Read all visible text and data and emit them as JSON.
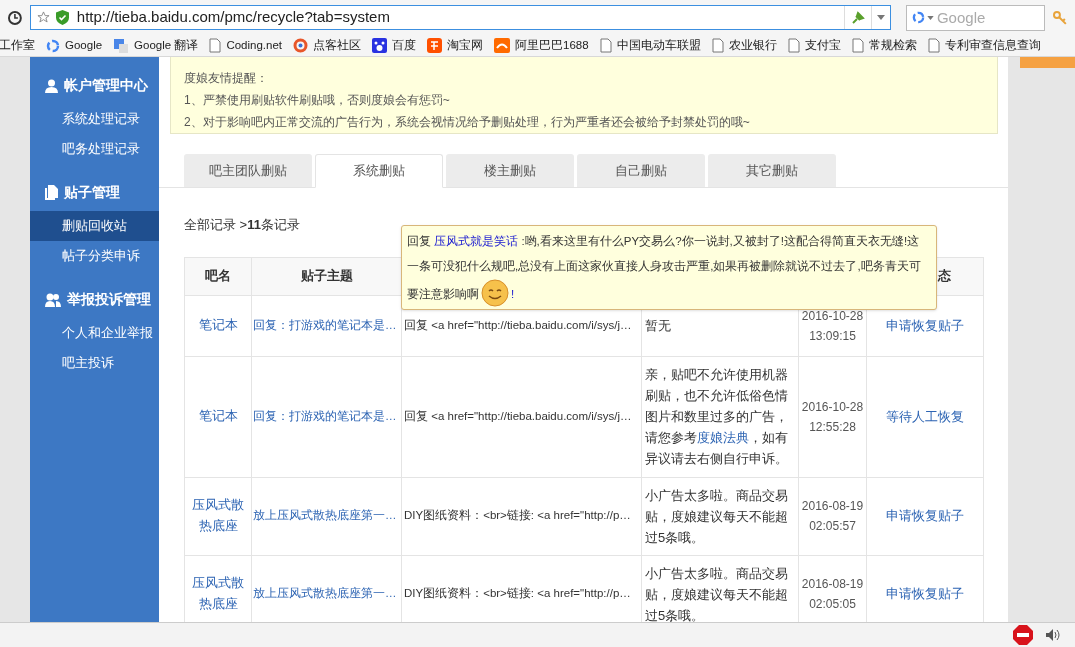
{
  "browser": {
    "url": "http://tieba.baidu.com/pmc/recycle?tab=system",
    "search_placeholder": "Google"
  },
  "bookmarks": [
    {
      "label": "工作室",
      "kind": "none"
    },
    {
      "label": "Google",
      "kind": "google"
    },
    {
      "label": "Google 翻译",
      "kind": "translate"
    },
    {
      "label": "Coding.net",
      "kind": "page"
    },
    {
      "label": "点客社区",
      "kind": "ring"
    },
    {
      "label": "百度",
      "kind": "paw"
    },
    {
      "label": "淘宝网",
      "kind": "taobao"
    },
    {
      "label": "阿里巴巴1688",
      "kind": "alibaba"
    },
    {
      "label": "中国电动车联盟",
      "kind": "page"
    },
    {
      "label": "农业银行",
      "kind": "page"
    },
    {
      "label": "支付宝",
      "kind": "page"
    },
    {
      "label": "常规检索",
      "kind": "page"
    },
    {
      "label": "专利审查信息查询",
      "kind": "page"
    }
  ],
  "sidebar": [
    {
      "title": "帐户管理中心",
      "kind": "user",
      "items": [
        {
          "label": "系统处理记录",
          "selected": false
        },
        {
          "label": "吧务处理记录",
          "selected": false
        }
      ]
    },
    {
      "title": "贴子管理",
      "kind": "docs",
      "items": [
        {
          "label": "删贴回收站",
          "selected": true
        },
        {
          "label": "帖子分类申诉",
          "selected": false
        }
      ]
    },
    {
      "title": "举报投诉管理",
      "kind": "users",
      "items": [
        {
          "label": "个人和企业举报",
          "selected": false
        },
        {
          "label": "吧主投诉",
          "selected": false
        }
      ]
    }
  ],
  "notice": {
    "title": "度娘友情提醒：",
    "lines": [
      "1、严禁使用刷贴软件刷贴哦，否则度娘会有惩罚~",
      "2、对于影响吧内正常交流的广告行为，系统会视情况给予删贴处理，行为严重者还会被给予封禁处罚的哦~"
    ]
  },
  "tabs": [
    {
      "label": "吧主团队删贴",
      "selected": false
    },
    {
      "label": "系统删贴",
      "selected": true
    },
    {
      "label": "楼主删贴",
      "selected": false
    },
    {
      "label": "自己删贴",
      "selected": false
    },
    {
      "label": "其它删贴",
      "selected": false
    }
  ],
  "breadcrumb": "全部记录 >**11**条记录",
  "table": {
    "headers": {
      "column_1": "吧名",
      "column_2": "贴子主题",
      "column_6": "态"
    },
    "rows": [
      {
        "forum": "笔记本",
        "topic": "回复：打游戏的笔记本是…",
        "content": "回复 <a href=\"http://tieba.baidu.com/i/sys/j…",
        "reason": "暂无",
        "date": "2016-10-28",
        "time": "13:09:15",
        "action": "申请恢复贴子"
      },
      {
        "forum": "笔记本",
        "topic": "回复：打游戏的笔记本是…",
        "content": "回复 <a href=\"http://tieba.baidu.com/i/sys/j…",
        "reason": "亲，贴吧不允许使用机器刷贴，也不允许低俗色情图片和数里过多的广告，请您参考",
        "reason_link": "度娘法典",
        "reason_tail": "，如有异议请去右侧自行申诉。",
        "date": "2016-10-28",
        "time": "12:55:28",
        "action": "等待人工恢复"
      },
      {
        "forum": "压风式散热底座",
        "topic": "放上压风式散热底座第一…",
        "content": "DIY图纸资料：<br>链接: <a href=\"http://p…",
        "reason": "小广告太多啦。商品交易贴，度娘建议每天不能超过5条哦。",
        "date": "2016-08-19",
        "time": "02:05:57",
        "action": "申请恢复贴子"
      },
      {
        "forum": "压风式散热底座",
        "topic": "放上压风式散热底座第一…",
        "content": "DIY图纸资料：<br>链接: <a href=\"http://p…",
        "reason": "小广告太多啦。商品交易贴，度娘建议每天不能超过5条哦。",
        "date": "2016-08-19",
        "time": "02:05:05",
        "action": "申请恢复贴子"
      }
    ]
  },
  "tooltip": {
    "reply": "回复",
    "user": "压风式就是笑话",
    "text": " :哟,看来这里有什么PY交易么?你一说封,又被封了!这配合得简直天衣无缝!这一条可没犯什么规吧,总没有上面这家伙直接人身攻击严重,如果再被删除就说不过去了,吧务青天可要注意影响啊",
    "end": "!"
  }
}
